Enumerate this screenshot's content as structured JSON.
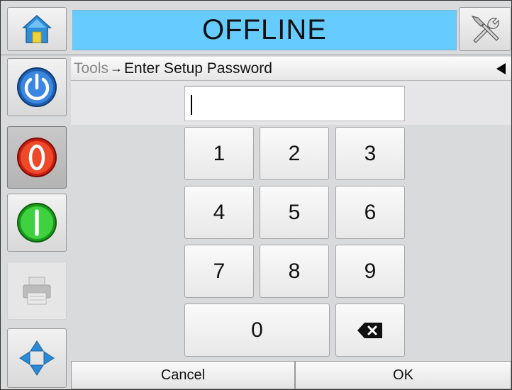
{
  "header": {
    "status": "OFFLINE",
    "home_icon": "home-icon",
    "tools_icon": "tools-icon",
    "status_color": "#66ccff"
  },
  "sidebar": {
    "items": [
      {
        "name": "power",
        "icon": "power-icon"
      },
      {
        "name": "stop",
        "icon": "stop-icon"
      },
      {
        "name": "start",
        "icon": "start-icon"
      },
      {
        "name": "print",
        "icon": "printer-icon"
      },
      {
        "name": "navigate",
        "icon": "navigation-arrows-icon"
      }
    ]
  },
  "breadcrumb": {
    "root": "Tools",
    "separator": "→",
    "current": "Enter Setup Password"
  },
  "password": {
    "value": ""
  },
  "keypad": {
    "k1": "1",
    "k2": "2",
    "k3": "3",
    "k4": "4",
    "k5": "5",
    "k6": "6",
    "k7": "7",
    "k8": "8",
    "k9": "9",
    "k0": "0",
    "backspace_icon": "backspace-icon"
  },
  "footer": {
    "cancel": "Cancel",
    "ok": "OK"
  }
}
